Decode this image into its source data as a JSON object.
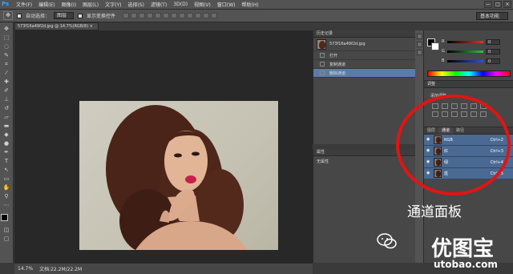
{
  "app": {
    "logo": "Ps"
  },
  "menu": [
    "文件(F)",
    "编辑(E)",
    "图像(I)",
    "图层(L)",
    "文字(Y)",
    "选择(S)",
    "滤镜(T)",
    "3D(D)",
    "视图(V)",
    "窗口(W)",
    "帮助(H)"
  ],
  "window_buttons": [
    "—",
    "□",
    "×"
  ],
  "options": {
    "auto_select_label": "自动选择：",
    "auto_select_value": "图层",
    "show_transform_label": "显示变换控件",
    "workspace": "基本功能"
  },
  "document": {
    "tab_title": "573f16a49f2d.jpg @ 14.7%(RGB/8) ×",
    "status_zoom": "14.7%",
    "status_doc": "文档:22.2M/22.2M"
  },
  "history": {
    "tab": "历史记录",
    "snapshot": "573f16a49f2d.jpg",
    "steps": [
      "打开",
      "复制通道",
      "删除通道"
    ]
  },
  "properties": {
    "tab": "属性",
    "content": "无属性"
  },
  "color_panel": {
    "sliders": [
      {
        "label": "R",
        "value": "0",
        "color": "#e03030"
      },
      {
        "label": "G",
        "value": "0",
        "color": "#30c040"
      },
      {
        "label": "B",
        "value": "0",
        "color": "#3050e0"
      }
    ]
  },
  "adjustments": {
    "tab": "调整",
    "title": "添加调整"
  },
  "channels_panel": {
    "tabs": [
      "图层",
      "通道",
      "路径"
    ],
    "active_tab": "通道",
    "channels": [
      {
        "name": "RGB",
        "shortcut": "Ctrl+2"
      },
      {
        "name": "红",
        "shortcut": "Ctrl+3"
      },
      {
        "name": "绿",
        "shortcut": "Ctrl+4"
      },
      {
        "name": "蓝",
        "shortcut": "Ctrl+5"
      }
    ]
  },
  "annotation": {
    "label": "通道面板",
    "color": "#e21414"
  },
  "watermark": {
    "logo": "优图宝",
    "url": "utobao.com"
  }
}
